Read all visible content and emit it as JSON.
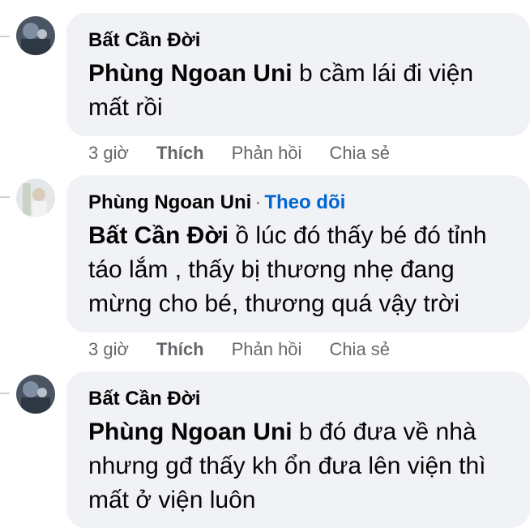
{
  "comments": [
    {
      "author": "Bất Cần Đời",
      "follow": "",
      "mention": "Phùng Ngoan Uni",
      "text": " b cầm lái đi viện mất rồi",
      "time": "3 giờ",
      "like": "Thích",
      "reply": "Phản hồi",
      "share": "Chia sẻ"
    },
    {
      "author": "Phùng Ngoan Uni",
      "separator": "·",
      "follow": "Theo dõi",
      "mention": "Bất Cần Đời",
      "text": " ồ lúc đó thấy bé đó tỉnh táo lắm , thấy bị thương nhẹ đang mừng cho bé, thương quá vậy trời",
      "time": "3 giờ",
      "like": "Thích",
      "reply": "Phản hồi",
      "share": "Chia sẻ"
    },
    {
      "author": "Bất Cần Đời",
      "follow": "",
      "mention": "Phùng Ngoan Uni",
      "text": " b đó đưa về nhà nhưng gđ thấy kh ổn đưa lên viện thì mất ở viện luôn"
    }
  ],
  "colors": {
    "bubble": "#f0f2f5",
    "link": "#0064d1",
    "meta": "#65676b"
  }
}
